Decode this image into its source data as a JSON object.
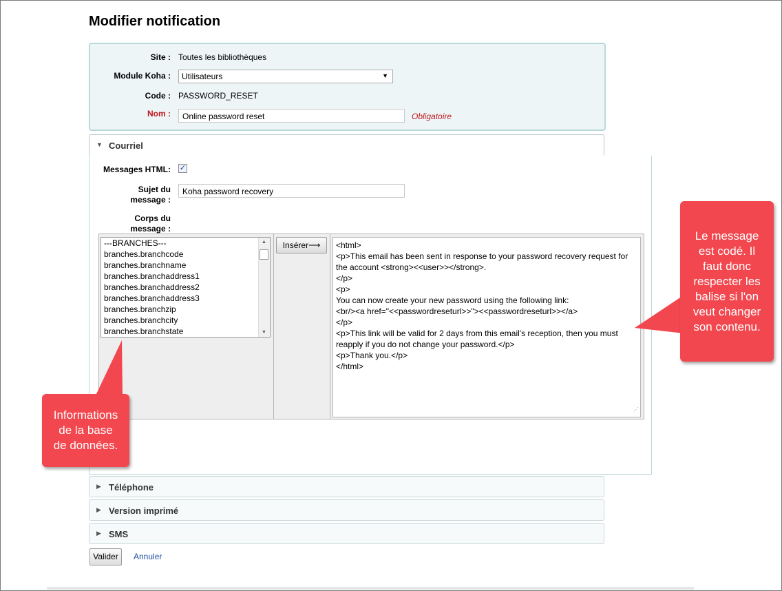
{
  "page": {
    "title": "Modifier notification"
  },
  "form": {
    "site_label": "Site :",
    "site_value": "Toutes les bibliothèques",
    "module_label": "Module Koha :",
    "module_value": "Utilisateurs",
    "code_label": "Code :",
    "code_value": "PASSWORD_RESET",
    "nom_label": "Nom :",
    "nom_value": "Online password reset",
    "required_text": "Obligatoire"
  },
  "courriel": {
    "title": "Courriel",
    "html_label": "Messages HTML:",
    "html_checked": true,
    "subject_label_1": "Sujet du",
    "subject_label_2": "message :",
    "subject_value": "Koha password recovery",
    "body_label_1": "Corps du",
    "body_label_2": "message :",
    "fields": [
      "---BRANCHES---",
      "branches.branchcode",
      "branches.branchname",
      "branches.branchaddress1",
      "branches.branchaddress2",
      "branches.branchaddress3",
      "branches.branchzip",
      "branches.branchcity",
      "branches.branchstate"
    ],
    "insert_label": "Insérer⟶",
    "body_lines": [
      "<html>",
      "<p>This email has been sent in response to your password recovery request for",
      "the account <strong><<user>></strong>.",
      "</p>",
      "<p>",
      "You can now create your new password using the following link:",
      "<br/><a href=\"<<passwordreseturl>>\"><<passwordreseturl>></a>",
      "</p>",
      "<p>This link will be valid for 2 days from this email's reception, then you must",
      "reapply if you do not change your password.</p>",
      "<p>Thank you.</p>",
      "</html>"
    ]
  },
  "sections": {
    "telephone": "Téléphone",
    "print": "Version imprimé",
    "sms": "SMS"
  },
  "actions": {
    "submit": "Valider",
    "cancel": "Annuler"
  },
  "callouts": {
    "left": [
      "Informations",
      "de la base",
      "de données."
    ],
    "right": [
      "Le message",
      "est codé. Il",
      "faut donc",
      "respecter les",
      "balise si l'on",
      "veut changer",
      "son contenu."
    ]
  },
  "colors": {
    "callout": "#f2474e",
    "required_label": "#c0171d",
    "link": "#1c4fa0",
    "panel_border": "#b9d8d9"
  }
}
